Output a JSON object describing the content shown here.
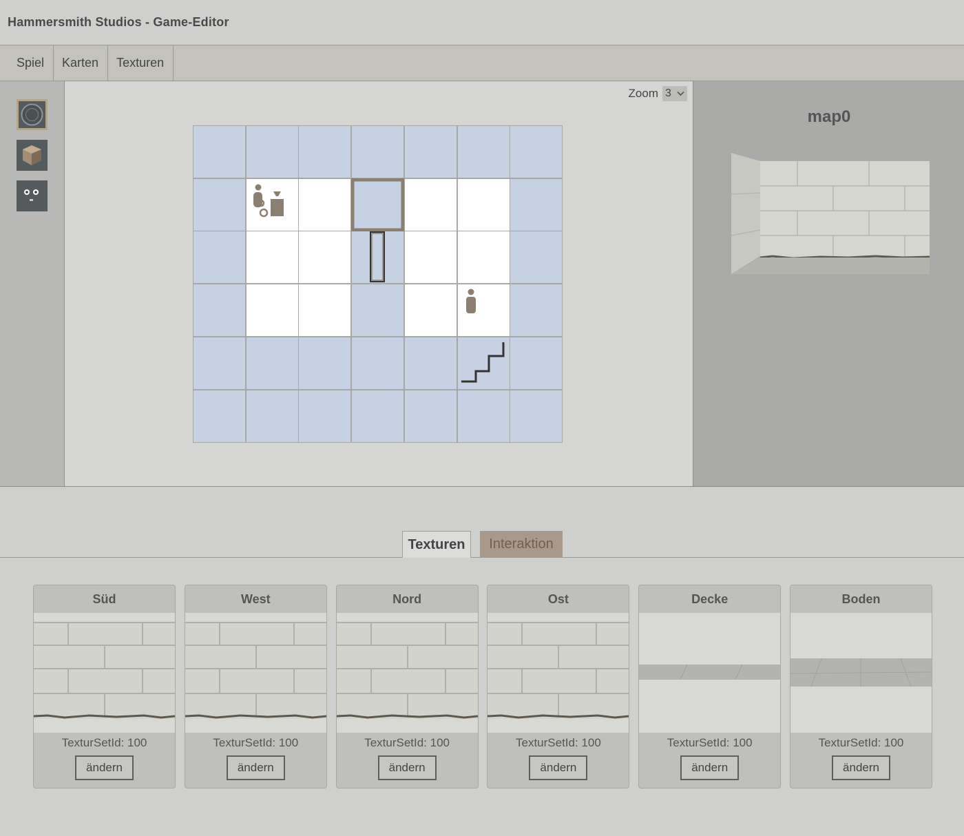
{
  "window": {
    "title": "Hammersmith Studios - Game-Editor"
  },
  "menu": {
    "items": [
      {
        "label": "Spiel"
      },
      {
        "label": "Karten"
      },
      {
        "label": "Texturen"
      }
    ]
  },
  "tools": [
    {
      "icon": "circle-tool-icon",
      "selected": true
    },
    {
      "icon": "cube-tool-icon",
      "selected": false
    },
    {
      "icon": "face-tool-icon",
      "selected": false
    }
  ],
  "editor": {
    "zoom_label": "Zoom",
    "zoom_value": "3",
    "grid": {
      "cols": 7,
      "rows": 6,
      "floor_cells": [
        [
          1,
          1
        ],
        [
          2,
          1
        ],
        [
          4,
          1
        ],
        [
          5,
          1
        ],
        [
          1,
          2
        ],
        [
          2,
          2
        ],
        [
          4,
          2
        ],
        [
          5,
          2
        ],
        [
          1,
          3
        ],
        [
          2,
          3
        ],
        [
          4,
          3
        ],
        [
          5,
          3
        ]
      ],
      "markers": [
        {
          "icon": "npc-vendor-icon",
          "col": 1,
          "row": 1
        },
        {
          "icon": "selection-frame",
          "col": 3,
          "row": 1
        },
        {
          "icon": "door-icon",
          "col": 3,
          "row": 2
        },
        {
          "icon": "person-icon",
          "col": 5,
          "row": 3
        },
        {
          "icon": "stairs-icon",
          "col": 5,
          "row": 4
        }
      ]
    },
    "colors": {
      "wall": "#c6d2e4",
      "floor": "#ffffff",
      "marker": "#8b7f72"
    }
  },
  "preview": {
    "map_name": "map0"
  },
  "tabs": [
    {
      "label": "Texturen",
      "active": true
    },
    {
      "label": "Interaktion",
      "active": false
    }
  ],
  "textures": {
    "id_prefix": "TexturSetId: ",
    "button_label": "ändern",
    "cards": [
      {
        "title": "Süd",
        "texture_set_id": "TexturSetId: 100",
        "kind": "wall"
      },
      {
        "title": "West",
        "texture_set_id": "TexturSetId: 100",
        "kind": "wall"
      },
      {
        "title": "Nord",
        "texture_set_id": "TexturSetId: 100",
        "kind": "wall"
      },
      {
        "title": "Ost",
        "texture_set_id": "TexturSetId: 100",
        "kind": "wall"
      },
      {
        "title": "Decke",
        "texture_set_id": "TexturSetId: 100",
        "kind": "ceiling"
      },
      {
        "title": "Boden",
        "texture_set_id": "TexturSetId: 100",
        "kind": "floor"
      }
    ]
  }
}
